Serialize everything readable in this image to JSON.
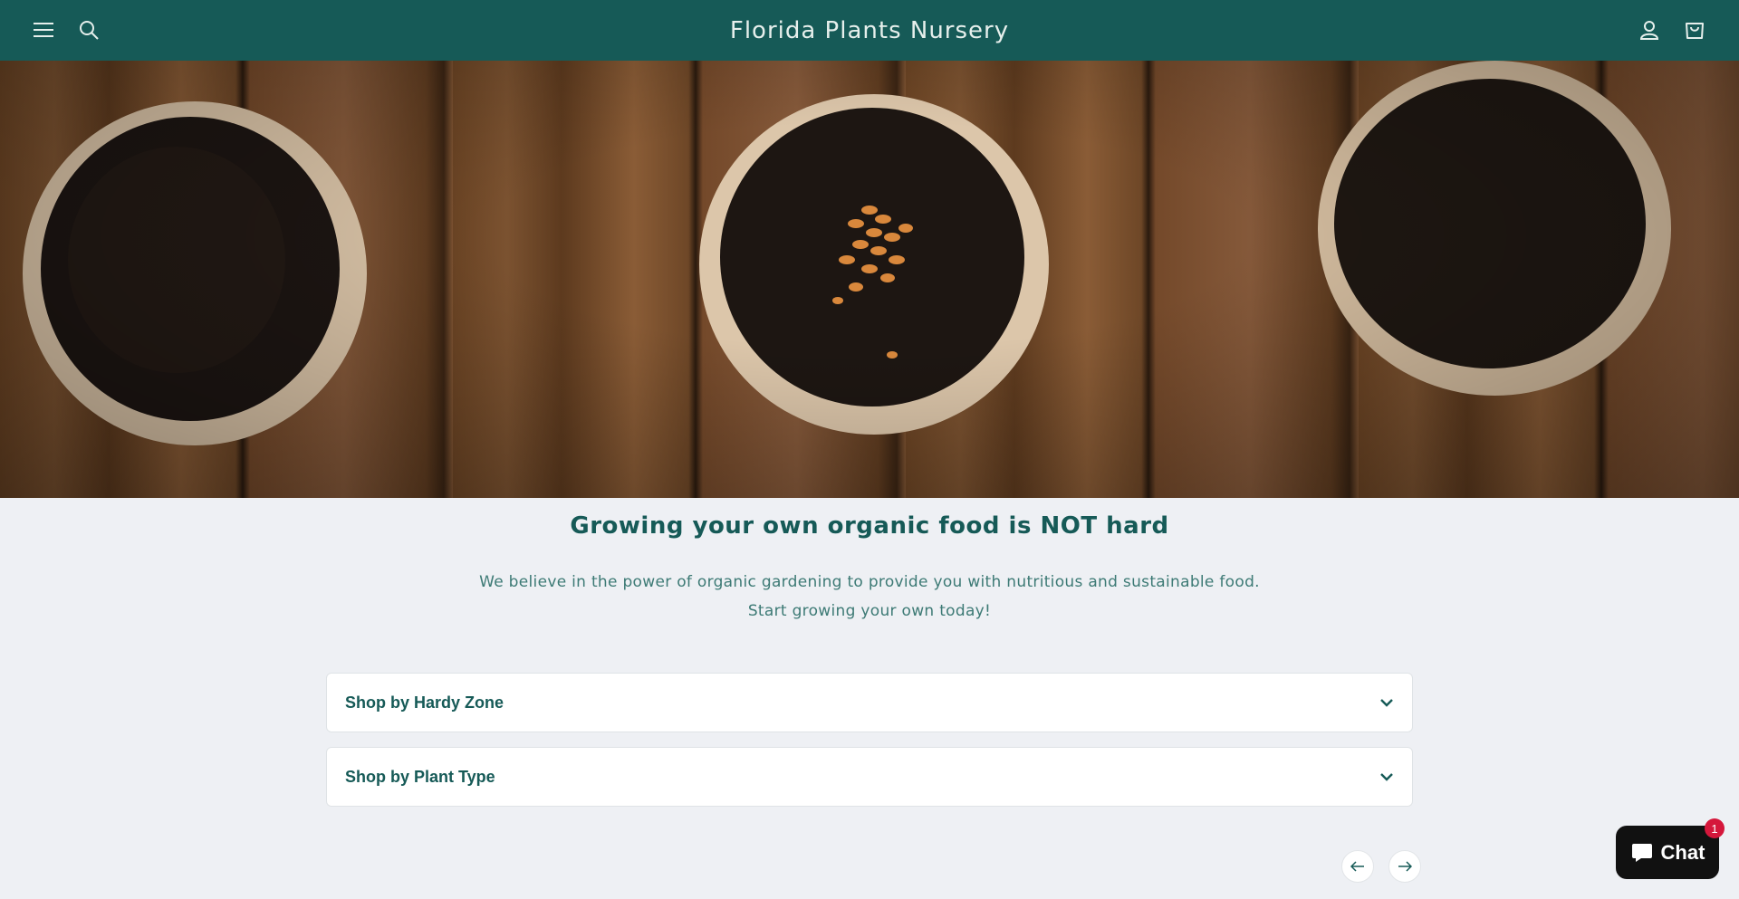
{
  "header": {
    "title": "Florida Plants Nursery",
    "menu_icon": "menu-icon",
    "search_icon": "search-icon",
    "account_icon": "account-icon",
    "cart_icon": "cart-icon",
    "bg_color": "#165a57"
  },
  "hero": {
    "image": "three peat pots with soil and seeds on wooden boards"
  },
  "intro": {
    "heading": "Growing your own organic food is NOT hard",
    "line1": "We believe in the power of organic gardening to provide you with nutritious and sustainable food.",
    "line2": "Start growing your own today!"
  },
  "accordions": [
    {
      "label": "Shop by Hardy Zone",
      "icon": "chevron-down-icon"
    },
    {
      "label": "Shop by Plant Type",
      "icon": "chevron-down-icon"
    }
  ],
  "slider": {
    "prev_icon": "arrow-left-icon",
    "next_icon": "arrow-right-icon"
  },
  "chat": {
    "label": "Chat",
    "badge": "1",
    "icon": "chat-bubble-icon"
  }
}
